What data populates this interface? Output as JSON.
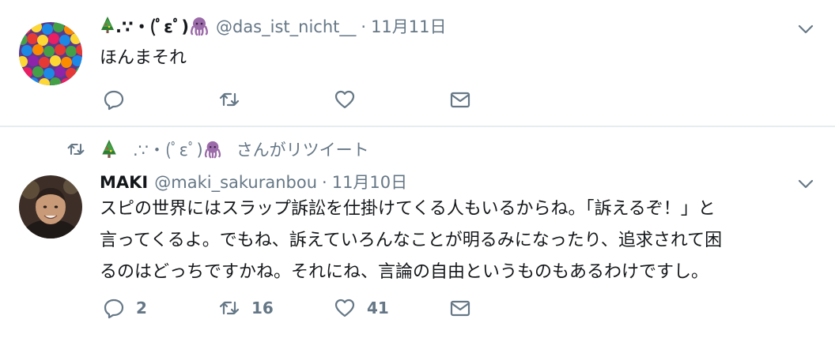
{
  "tweets": [
    {
      "display_name": ".∵・(ﾟεﾟ)",
      "handle": "@das_ist_nicht__",
      "separator": "·",
      "date": "11月11日",
      "text": "ほんまそれ",
      "counts": {
        "reply": "",
        "retweet": "",
        "like": ""
      }
    },
    {
      "retweeted_by": ".∵・(ﾟεﾟ)",
      "retweet_suffix": "さんがリツイート",
      "display_name": "MAKI",
      "handle": "@maki_sakuranbou",
      "separator": "·",
      "date": "11月10日",
      "text_lines": [
        "スピの世界にはスラップ訴訟を仕掛けてくる人もいるからね。「訴えるぞ！」と",
        "言ってくるよ。でもね、訴えていろんなことが明るみになったり、追求されて困",
        "るのはどっちですかね。それにね、言論の自由というものもあるわけですし。"
      ],
      "counts": {
        "reply": "2",
        "retweet": "16",
        "like": "41"
      }
    }
  ],
  "icons": {
    "reply": "reply-icon",
    "retweet": "retweet-icon",
    "like": "heart-icon",
    "dm": "envelope-icon",
    "more": "chevron-down-icon",
    "tree_emoji": "christmas-tree-emoji",
    "octopus_emoji": "octopus-emoji"
  },
  "colors": {
    "secondary_text": "#657786",
    "primary_text": "#14171a",
    "divider": "#e6ecf0",
    "octopus": "#9b6aa8",
    "tree": "#2e7d32"
  }
}
